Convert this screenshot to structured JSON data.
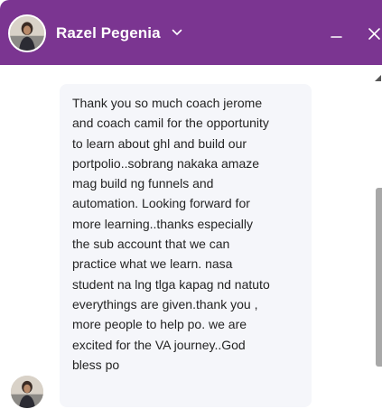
{
  "header": {
    "contact_name": "Razel Pegenia",
    "icons": {
      "dropdown": "chevron-down-icon",
      "minimize": "minimize-icon",
      "close": "close-icon"
    }
  },
  "conversation": {
    "messages": [
      {
        "text": "Thank you so much coach jerome\nand coach camil for the opportunity\nto learn about ghl and build our\nportpolio..sobrang nakaka amaze\nmag build ng funnels and\nautomation. Looking forward for\nmore learning..thanks especially\nthe sub account that we can\npractice what we learn. nasa\nstudent na lng tlga kapag nd natuto\neverythings are given.thank you ,\nmore people to help po. we are\nexcited for the VA journey..God\nbless po"
      }
    ]
  },
  "colors": {
    "header_background": "#7b3591",
    "bubble_background": "#f5f6fa",
    "text": "#242424",
    "scrollbar": "#a8a8a8"
  }
}
